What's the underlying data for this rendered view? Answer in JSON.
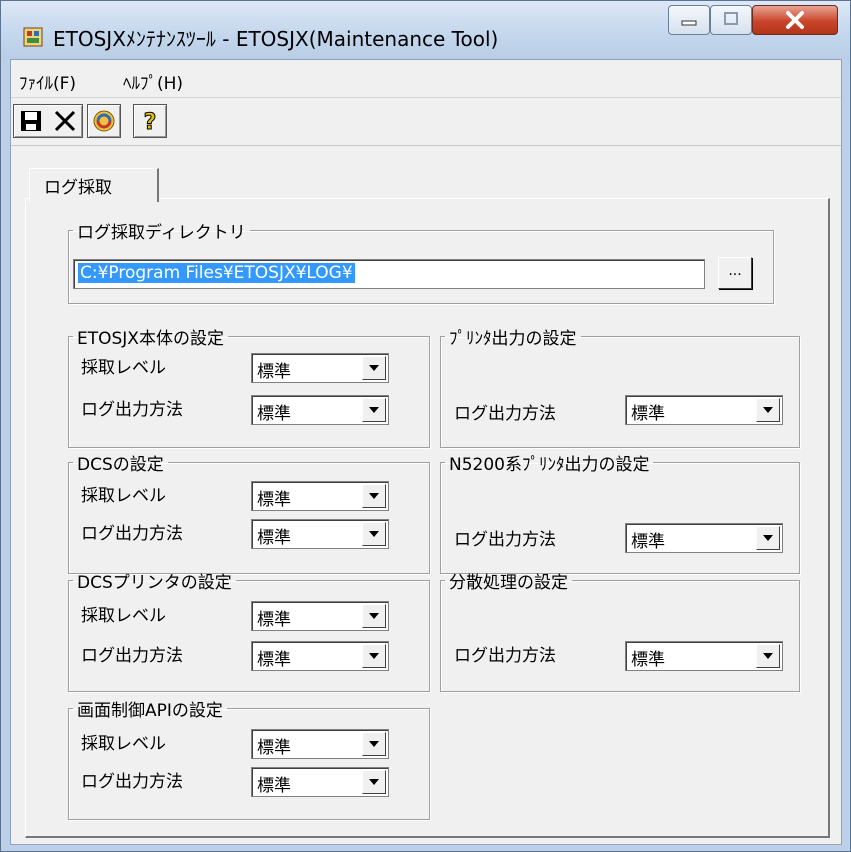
{
  "window": {
    "title": "ETOSJXﾒﾝﾃﾅﾝｽﾂｰﾙ - ETOSJX(Maintenance Tool)"
  },
  "menu": {
    "file": "ﾌｧｲﾙ(F)",
    "help": "ﾍﾙﾌﾟ(H)"
  },
  "toolbar": {
    "icons": [
      "save-icon",
      "delete-icon",
      "refresh-icon",
      "help-icon"
    ]
  },
  "tab": {
    "label": "ログ採取"
  },
  "log_dir": {
    "label": "ログ採取ディレクトリ",
    "value": "C:¥Program Files¥ETOSJX¥LOG¥",
    "browse": "..."
  },
  "labels": {
    "level": "採取レベル",
    "method": "ログ出力方法"
  },
  "groups": {
    "etosjx": {
      "title": "ETOSJX本体の設定",
      "level": "標準",
      "method": "標準"
    },
    "dcs": {
      "title": "DCSの設定",
      "level": "標準",
      "method": "標準"
    },
    "dcs_printer": {
      "title": "DCSプリンタの設定",
      "level": "標準",
      "method": "標準"
    },
    "screen_api": {
      "title": "画面制御APIの設定",
      "level": "標準",
      "method": "標準"
    },
    "printer": {
      "title": "ﾌﾟﾘﾝﾀ出力の設定",
      "method": "標準"
    },
    "n5200": {
      "title": "N5200系ﾌﾟﾘﾝﾀ出力の設定",
      "method": "標準"
    },
    "distributed": {
      "title": "分散処理の設定",
      "method": "標準"
    }
  }
}
